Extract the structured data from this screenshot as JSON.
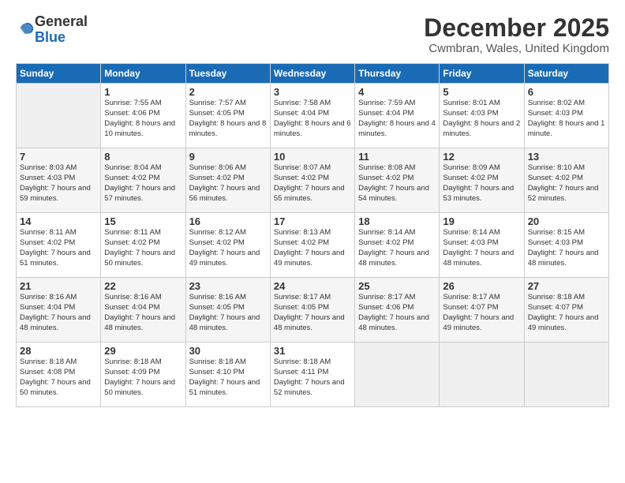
{
  "logo": {
    "general": "General",
    "blue": "Blue"
  },
  "title": "December 2025",
  "subtitle": "Cwmbran, Wales, United Kingdom",
  "days_of_week": [
    "Sunday",
    "Monday",
    "Tuesday",
    "Wednesday",
    "Thursday",
    "Friday",
    "Saturday"
  ],
  "weeks": [
    [
      {
        "day": "",
        "sunrise": "",
        "sunset": "",
        "daylight": ""
      },
      {
        "day": "1",
        "sunrise": "Sunrise: 7:55 AM",
        "sunset": "Sunset: 4:06 PM",
        "daylight": "Daylight: 8 hours and 10 minutes."
      },
      {
        "day": "2",
        "sunrise": "Sunrise: 7:57 AM",
        "sunset": "Sunset: 4:05 PM",
        "daylight": "Daylight: 8 hours and 8 minutes."
      },
      {
        "day": "3",
        "sunrise": "Sunrise: 7:58 AM",
        "sunset": "Sunset: 4:04 PM",
        "daylight": "Daylight: 8 hours and 6 minutes."
      },
      {
        "day": "4",
        "sunrise": "Sunrise: 7:59 AM",
        "sunset": "Sunset: 4:04 PM",
        "daylight": "Daylight: 8 hours and 4 minutes."
      },
      {
        "day": "5",
        "sunrise": "Sunrise: 8:01 AM",
        "sunset": "Sunset: 4:03 PM",
        "daylight": "Daylight: 8 hours and 2 minutes."
      },
      {
        "day": "6",
        "sunrise": "Sunrise: 8:02 AM",
        "sunset": "Sunset: 4:03 PM",
        "daylight": "Daylight: 8 hours and 1 minute."
      }
    ],
    [
      {
        "day": "7",
        "sunrise": "Sunrise: 8:03 AM",
        "sunset": "Sunset: 4:03 PM",
        "daylight": "Daylight: 7 hours and 59 minutes."
      },
      {
        "day": "8",
        "sunrise": "Sunrise: 8:04 AM",
        "sunset": "Sunset: 4:02 PM",
        "daylight": "Daylight: 7 hours and 57 minutes."
      },
      {
        "day": "9",
        "sunrise": "Sunrise: 8:06 AM",
        "sunset": "Sunset: 4:02 PM",
        "daylight": "Daylight: 7 hours and 56 minutes."
      },
      {
        "day": "10",
        "sunrise": "Sunrise: 8:07 AM",
        "sunset": "Sunset: 4:02 PM",
        "daylight": "Daylight: 7 hours and 55 minutes."
      },
      {
        "day": "11",
        "sunrise": "Sunrise: 8:08 AM",
        "sunset": "Sunset: 4:02 PM",
        "daylight": "Daylight: 7 hours and 54 minutes."
      },
      {
        "day": "12",
        "sunrise": "Sunrise: 8:09 AM",
        "sunset": "Sunset: 4:02 PM",
        "daylight": "Daylight: 7 hours and 53 minutes."
      },
      {
        "day": "13",
        "sunrise": "Sunrise: 8:10 AM",
        "sunset": "Sunset: 4:02 PM",
        "daylight": "Daylight: 7 hours and 52 minutes."
      }
    ],
    [
      {
        "day": "14",
        "sunrise": "Sunrise: 8:11 AM",
        "sunset": "Sunset: 4:02 PM",
        "daylight": "Daylight: 7 hours and 51 minutes."
      },
      {
        "day": "15",
        "sunrise": "Sunrise: 8:11 AM",
        "sunset": "Sunset: 4:02 PM",
        "daylight": "Daylight: 7 hours and 50 minutes."
      },
      {
        "day": "16",
        "sunrise": "Sunrise: 8:12 AM",
        "sunset": "Sunset: 4:02 PM",
        "daylight": "Daylight: 7 hours and 49 minutes."
      },
      {
        "day": "17",
        "sunrise": "Sunrise: 8:13 AM",
        "sunset": "Sunset: 4:02 PM",
        "daylight": "Daylight: 7 hours and 49 minutes."
      },
      {
        "day": "18",
        "sunrise": "Sunrise: 8:14 AM",
        "sunset": "Sunset: 4:02 PM",
        "daylight": "Daylight: 7 hours and 48 minutes."
      },
      {
        "day": "19",
        "sunrise": "Sunrise: 8:14 AM",
        "sunset": "Sunset: 4:03 PM",
        "daylight": "Daylight: 7 hours and 48 minutes."
      },
      {
        "day": "20",
        "sunrise": "Sunrise: 8:15 AM",
        "sunset": "Sunset: 4:03 PM",
        "daylight": "Daylight: 7 hours and 48 minutes."
      }
    ],
    [
      {
        "day": "21",
        "sunrise": "Sunrise: 8:16 AM",
        "sunset": "Sunset: 4:04 PM",
        "daylight": "Daylight: 7 hours and 48 minutes."
      },
      {
        "day": "22",
        "sunrise": "Sunrise: 8:16 AM",
        "sunset": "Sunset: 4:04 PM",
        "daylight": "Daylight: 7 hours and 48 minutes."
      },
      {
        "day": "23",
        "sunrise": "Sunrise: 8:16 AM",
        "sunset": "Sunset: 4:05 PM",
        "daylight": "Daylight: 7 hours and 48 minutes."
      },
      {
        "day": "24",
        "sunrise": "Sunrise: 8:17 AM",
        "sunset": "Sunset: 4:05 PM",
        "daylight": "Daylight: 7 hours and 48 minutes."
      },
      {
        "day": "25",
        "sunrise": "Sunrise: 8:17 AM",
        "sunset": "Sunset: 4:06 PM",
        "daylight": "Daylight: 7 hours and 48 minutes."
      },
      {
        "day": "26",
        "sunrise": "Sunrise: 8:17 AM",
        "sunset": "Sunset: 4:07 PM",
        "daylight": "Daylight: 7 hours and 49 minutes."
      },
      {
        "day": "27",
        "sunrise": "Sunrise: 8:18 AM",
        "sunset": "Sunset: 4:07 PM",
        "daylight": "Daylight: 7 hours and 49 minutes."
      }
    ],
    [
      {
        "day": "28",
        "sunrise": "Sunrise: 8:18 AM",
        "sunset": "Sunset: 4:08 PM",
        "daylight": "Daylight: 7 hours and 50 minutes."
      },
      {
        "day": "29",
        "sunrise": "Sunrise: 8:18 AM",
        "sunset": "Sunset: 4:09 PM",
        "daylight": "Daylight: 7 hours and 50 minutes."
      },
      {
        "day": "30",
        "sunrise": "Sunrise: 8:18 AM",
        "sunset": "Sunset: 4:10 PM",
        "daylight": "Daylight: 7 hours and 51 minutes."
      },
      {
        "day": "31",
        "sunrise": "Sunrise: 8:18 AM",
        "sunset": "Sunset: 4:11 PM",
        "daylight": "Daylight: 7 hours and 52 minutes."
      },
      {
        "day": "",
        "sunrise": "",
        "sunset": "",
        "daylight": ""
      },
      {
        "day": "",
        "sunrise": "",
        "sunset": "",
        "daylight": ""
      },
      {
        "day": "",
        "sunrise": "",
        "sunset": "",
        "daylight": ""
      }
    ]
  ]
}
